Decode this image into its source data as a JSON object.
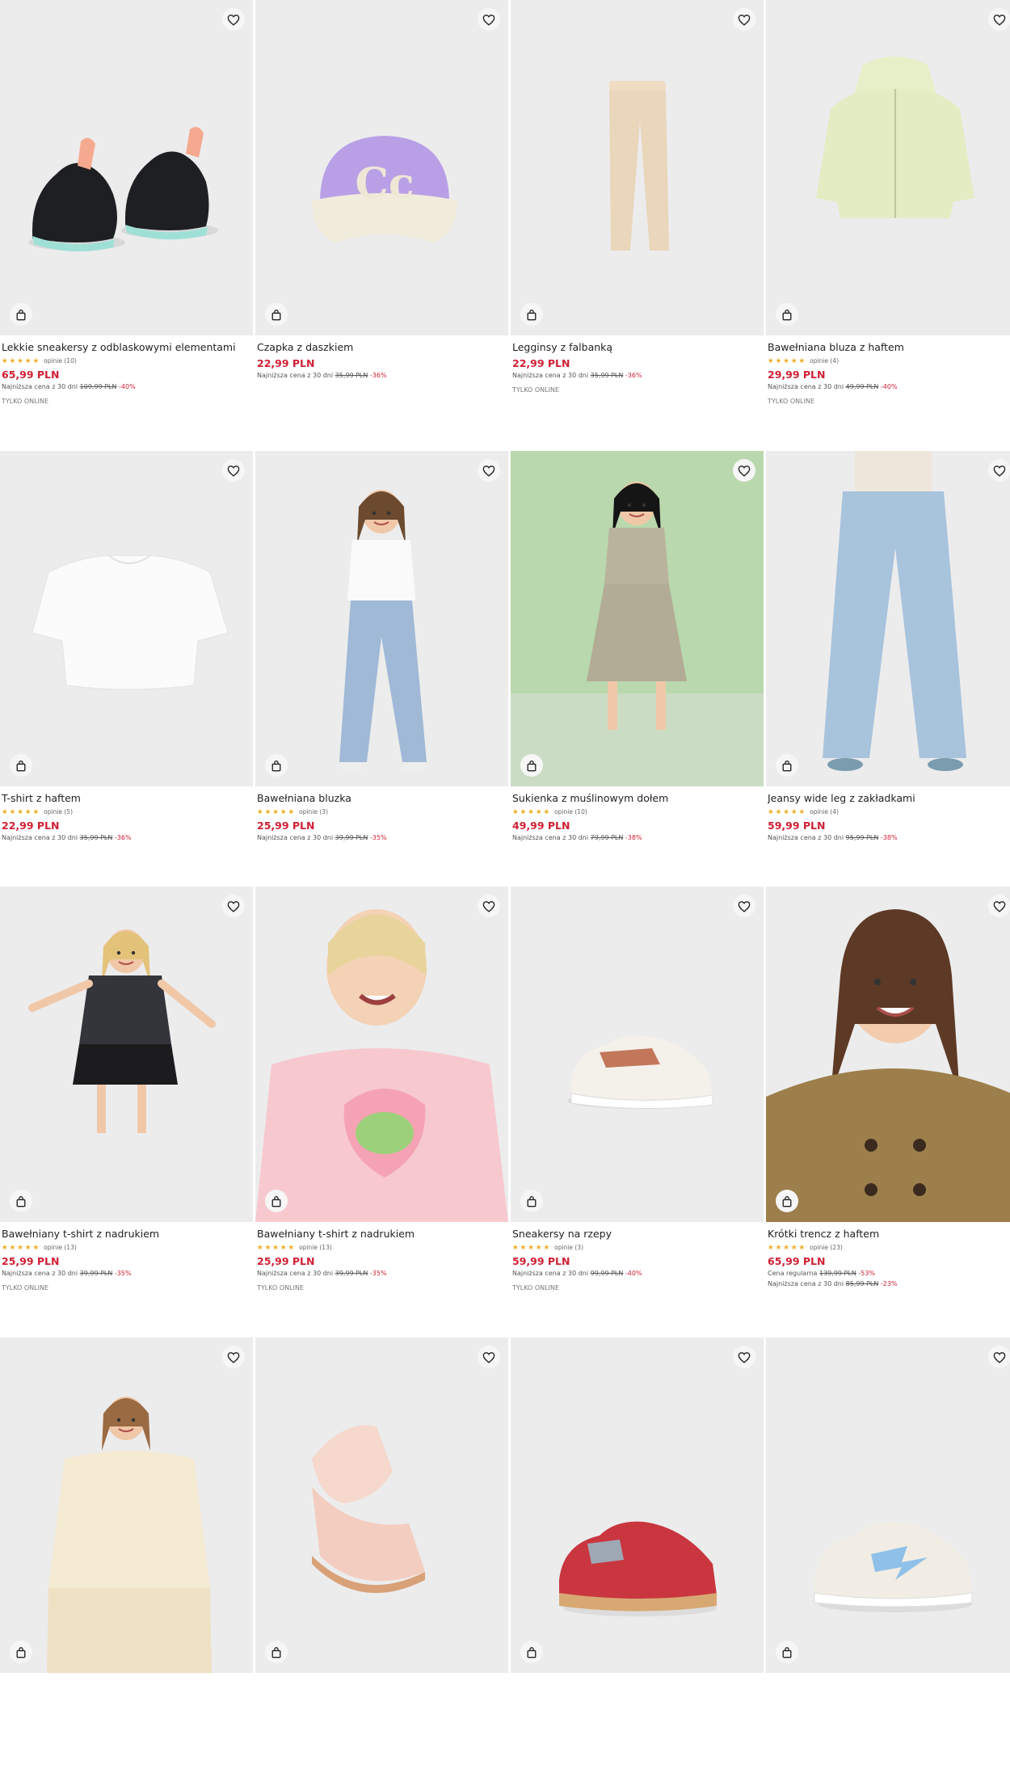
{
  "products": [
    {
      "name": "Lekkie sneakersy z odblaskowymi elementami",
      "rating": 5,
      "reviews": "opinie (10)",
      "price": "65,99 PLN",
      "lines": [
        {
          "label": "Najniższa cena z 30 dni",
          "old": "109,99 PLN",
          "discount": "-40%"
        }
      ],
      "tag": "TYLKO ONLINE",
      "image": "sneaker-black",
      "bg": "#ececed"
    },
    {
      "name": "Czapka z daszkiem",
      "rating": null,
      "reviews": "",
      "price": "22,99 PLN",
      "lines": [
        {
          "label": "Najniższa cena z 30 dni",
          "old": "35,99 PLN",
          "discount": "-36%"
        }
      ],
      "tag": "",
      "image": "cap-purple",
      "bg": "#ececed"
    },
    {
      "name": "Legginsy z falbanką",
      "rating": null,
      "reviews": "",
      "price": "22,99 PLN",
      "lines": [
        {
          "label": "Najniższa cena z 30 dni",
          "old": "35,99 PLN",
          "discount": "-36%"
        }
      ],
      "tag": "TYLKO ONLINE",
      "image": "leggings-beige",
      "bg": "#ececed"
    },
    {
      "name": "Bawełniana bluza z haftem",
      "rating": 5,
      "reviews": "opinie (4)",
      "price": "29,99 PLN",
      "lines": [
        {
          "label": "Najniższa cena z 30 dni",
          "old": "49,99 PLN",
          "discount": "-40%"
        }
      ],
      "tag": "TYLKO ONLINE",
      "image": "hoodie-green",
      "bg": "#ececed"
    },
    {
      "name": "T-shirt z haftem",
      "rating": 5,
      "reviews": "opinie (5)",
      "price": "22,99 PLN",
      "lines": [
        {
          "label": "Najniższa cena z 30 dni",
          "old": "35,99 PLN",
          "discount": "-36%"
        }
      ],
      "tag": "",
      "image": "tshirt-white",
      "bg": "#ececed"
    },
    {
      "name": "Bawełniana bluzka",
      "rating": 4.5,
      "reviews": "opinie (3)",
      "price": "25,99 PLN",
      "lines": [
        {
          "label": "Najniższa cena z 30 dni",
          "old": "39,99 PLN",
          "discount": "-35%"
        }
      ],
      "tag": "",
      "image": "girl-jeans",
      "bg": "#ececed"
    },
    {
      "name": "Sukienka z muślinowym dołem",
      "rating": 5,
      "reviews": "opinie (10)",
      "price": "49,99 PLN",
      "lines": [
        {
          "label": "Najniższa cena z 30 dni",
          "old": "79,99 PLN",
          "discount": "-38%"
        }
      ],
      "tag": "",
      "image": "girl-dress",
      "bg": "#b9d8ad"
    },
    {
      "name": "Jeansy wide leg z zakładkami",
      "rating": 5,
      "reviews": "opinie (4)",
      "price": "59,99 PLN",
      "lines": [
        {
          "label": "Najniższa cena z 30 dni",
          "old": "95,99 PLN",
          "discount": "-38%"
        }
      ],
      "tag": "",
      "image": "jeans-wide",
      "bg": "#ececed"
    },
    {
      "name": "Bawełniany t-shirt z nadrukiem",
      "rating": 5,
      "reviews": "opinie (13)",
      "price": "25,99 PLN",
      "lines": [
        {
          "label": "Najniższa cena z 30 dni",
          "old": "39,99 PLN",
          "discount": "-35%"
        }
      ],
      "tag": "TYLKO ONLINE",
      "image": "girl-black-tee",
      "bg": "#ececed"
    },
    {
      "name": "Bawełniany t-shirt z nadrukiem",
      "rating": 5,
      "reviews": "opinie (13)",
      "price": "25,99 PLN",
      "lines": [
        {
          "label": "Najniższa cena z 30 dni",
          "old": "39,99 PLN",
          "discount": "-35%"
        }
      ],
      "tag": "TYLKO ONLINE",
      "image": "girl-pink-tee",
      "bg": "#ececed"
    },
    {
      "name": "Sneakersy na rzepy",
      "rating": 5,
      "reviews": "opinie (3)",
      "price": "59,99 PLN",
      "lines": [
        {
          "label": "Najniższa cena z 30 dni",
          "old": "99,99 PLN",
          "discount": "-40%"
        }
      ],
      "tag": "TYLKO ONLINE",
      "image": "sneaker-white",
      "bg": "#ececed"
    },
    {
      "name": "Krótki trencz z haftem",
      "rating": 5,
      "reviews": "opinie (23)",
      "price": "65,99 PLN",
      "lines": [
        {
          "label": "Cena regularna",
          "old": "139,99 PLN",
          "discount": "-53%"
        },
        {
          "label": "Najniższa cena z 30 dni",
          "old": "85,99 PLN",
          "discount": "-23%"
        }
      ],
      "tag": "",
      "image": "girl-trench",
      "bg": "#ececed"
    },
    {
      "name": "",
      "rating": null,
      "reviews": "",
      "price": "",
      "lines": [],
      "tag": "",
      "image": "girl-top",
      "bg": "#ececed"
    },
    {
      "name": "",
      "rating": null,
      "reviews": "",
      "price": "",
      "lines": [],
      "tag": "",
      "image": "sneaker-pink",
      "bg": "#ececed"
    },
    {
      "name": "",
      "rating": null,
      "reviews": "",
      "price": "",
      "lines": [],
      "tag": "",
      "image": "sneaker-red",
      "bg": "#ececed"
    },
    {
      "name": "",
      "rating": null,
      "reviews": "",
      "price": "",
      "lines": [],
      "tag": "",
      "image": "sneaker-blue",
      "bg": "#ececed"
    }
  ],
  "icons": {
    "favorite": "heart-icon",
    "cart": "shopping-bag-icon"
  },
  "colors": {
    "price": "#d11f34",
    "star": "#f0a91b",
    "image_bg": "#ececed"
  }
}
